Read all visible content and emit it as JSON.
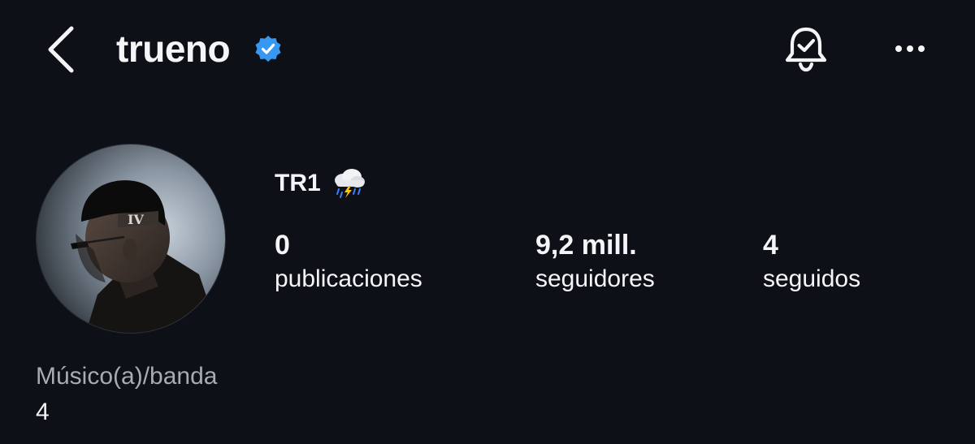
{
  "header": {
    "username": "trueno",
    "icons": {
      "back": "chevron-left-icon",
      "verified": "verified-badge-icon",
      "notifications": "bell-check-icon",
      "more": "more-horizontal-icon"
    }
  },
  "profile": {
    "display_name": "TR1",
    "display_name_emoji": "cloud-with-lightning-and-rain-icon",
    "stats": {
      "posts": {
        "value": "0",
        "label": "publicaciones"
      },
      "followers": {
        "value": "9,2 mill.",
        "label": "seguidores"
      },
      "following": {
        "value": "4",
        "label": "seguidos"
      }
    },
    "category": "Músico(a)/banda",
    "bio": "4"
  },
  "colors": {
    "background": "#0d1016",
    "text_primary": "#f5f5f7",
    "text_secondary": "#a8abb2",
    "verified_blue": "#3897f0"
  }
}
